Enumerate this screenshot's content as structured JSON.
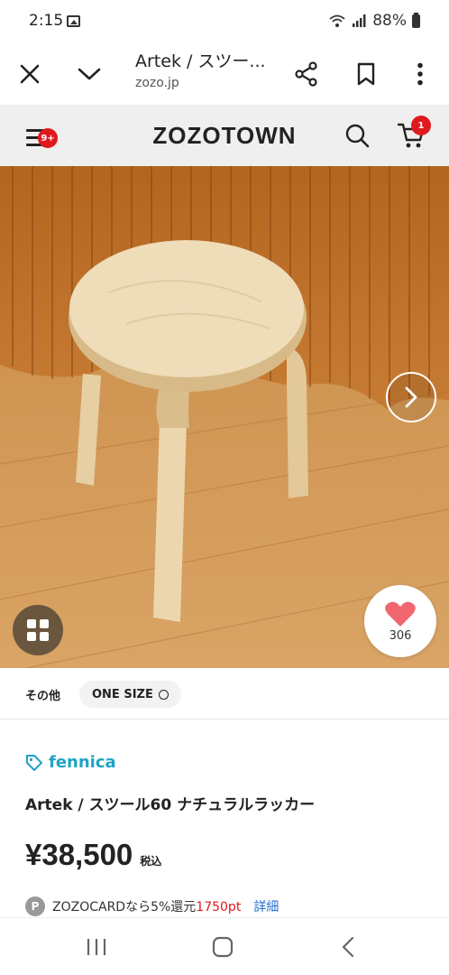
{
  "status_bar": {
    "time": "2:15",
    "battery": "88%"
  },
  "browser": {
    "title": "Artek / スツー...",
    "domain": "zozo.jp"
  },
  "site_header": {
    "logo": "ZOZOTOWN",
    "menu_badge": "9+",
    "cart_badge": "1"
  },
  "product_image": {
    "favorite_count": "306"
  },
  "size_row": {
    "color": "その他",
    "size": "ONE SIZE"
  },
  "product": {
    "brand": "fennica",
    "name": "Artek / スツール60 ナチュラルラッカー",
    "price": "¥38,500",
    "tax_label": "税込",
    "points_icon": "P",
    "points_text": "ZOZOCARDなら5%還元",
    "points_value": "1750pt",
    "points_detail": "詳細"
  },
  "colors": {
    "accent_red": "#e0191f",
    "brand_blue": "#1fa3c5",
    "link_blue": "#1f6fd1"
  }
}
